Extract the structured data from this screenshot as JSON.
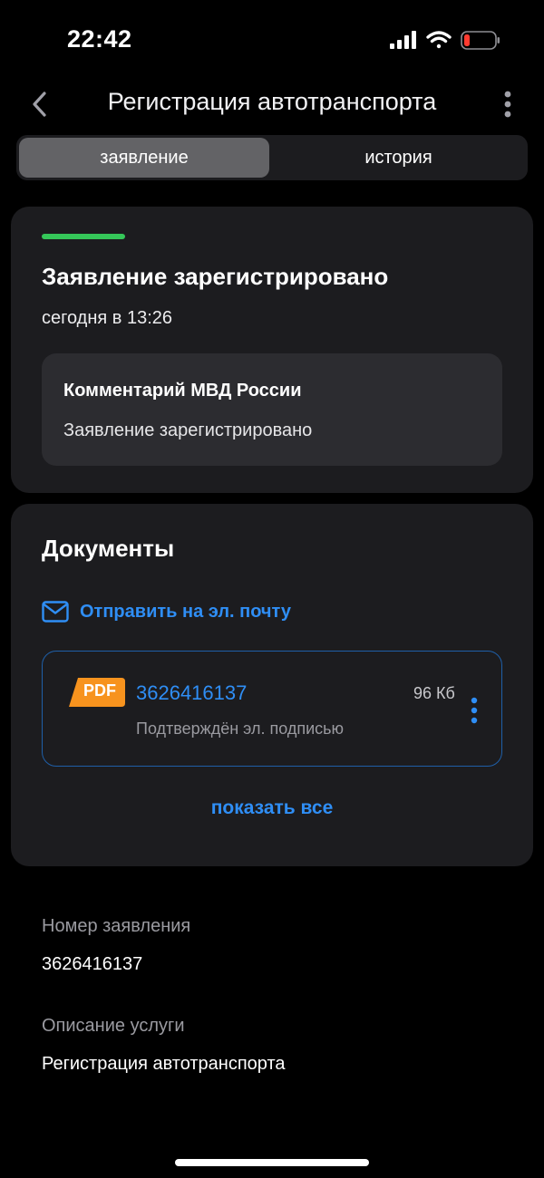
{
  "status_bar": {
    "time": "22:42",
    "icons": [
      "signal-icon",
      "wifi-icon",
      "battery-icon"
    ]
  },
  "header": {
    "title": "Регистрация автотранспорта",
    "back_icon": "chevron-left-icon",
    "menu_icon": "more-vertical-icon"
  },
  "tabs": [
    {
      "label": "заявление",
      "active": true
    },
    {
      "label": "история",
      "active": false
    }
  ],
  "status_card": {
    "title": "Заявление зарегистрировано",
    "time": "сегодня в 13:26",
    "indicator_color": "#35c759",
    "comment": {
      "title": "Комментарий МВД России",
      "text": "Заявление зарегистрировано"
    }
  },
  "documents": {
    "title": "Документы",
    "email_link": "Отправить на эл. почту",
    "email_icon": "mail-icon",
    "files": [
      {
        "badge": "PDF",
        "number": "3626416137",
        "size": "96 Кб",
        "subtitle": "Подтверждён эл. подписью"
      }
    ],
    "show_all": "показать все"
  },
  "info": {
    "application_number_label": "Номер заявления",
    "application_number": "3626416137",
    "service_description_label": "Описание услуги",
    "service_description": "Регистрация автотранспорта"
  },
  "colors": {
    "accent": "#2f8ef5",
    "success": "#35c759",
    "pdf_badge": "#f7931e",
    "card_bg": "#1c1c1f"
  }
}
